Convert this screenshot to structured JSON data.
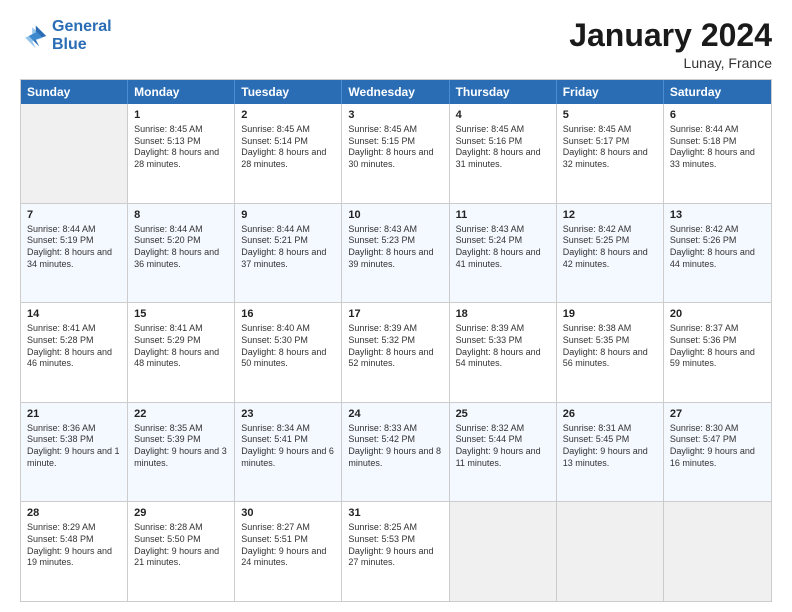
{
  "logo": {
    "line1": "General",
    "line2": "Blue"
  },
  "title": "January 2024",
  "location": "Lunay, France",
  "weekdays": [
    "Sunday",
    "Monday",
    "Tuesday",
    "Wednesday",
    "Thursday",
    "Friday",
    "Saturday"
  ],
  "rows": [
    [
      {
        "day": "",
        "sunrise": "",
        "sunset": "",
        "daylight": "",
        "empty": true
      },
      {
        "day": "1",
        "sunrise": "Sunrise: 8:45 AM",
        "sunset": "Sunset: 5:13 PM",
        "daylight": "Daylight: 8 hours and 28 minutes."
      },
      {
        "day": "2",
        "sunrise": "Sunrise: 8:45 AM",
        "sunset": "Sunset: 5:14 PM",
        "daylight": "Daylight: 8 hours and 28 minutes."
      },
      {
        "day": "3",
        "sunrise": "Sunrise: 8:45 AM",
        "sunset": "Sunset: 5:15 PM",
        "daylight": "Daylight: 8 hours and 30 minutes."
      },
      {
        "day": "4",
        "sunrise": "Sunrise: 8:45 AM",
        "sunset": "Sunset: 5:16 PM",
        "daylight": "Daylight: 8 hours and 31 minutes."
      },
      {
        "day": "5",
        "sunrise": "Sunrise: 8:45 AM",
        "sunset": "Sunset: 5:17 PM",
        "daylight": "Daylight: 8 hours and 32 minutes."
      },
      {
        "day": "6",
        "sunrise": "Sunrise: 8:44 AM",
        "sunset": "Sunset: 5:18 PM",
        "daylight": "Daylight: 8 hours and 33 minutes."
      }
    ],
    [
      {
        "day": "7",
        "sunrise": "Sunrise: 8:44 AM",
        "sunset": "Sunset: 5:19 PM",
        "daylight": "Daylight: 8 hours and 34 minutes."
      },
      {
        "day": "8",
        "sunrise": "Sunrise: 8:44 AM",
        "sunset": "Sunset: 5:20 PM",
        "daylight": "Daylight: 8 hours and 36 minutes."
      },
      {
        "day": "9",
        "sunrise": "Sunrise: 8:44 AM",
        "sunset": "Sunset: 5:21 PM",
        "daylight": "Daylight: 8 hours and 37 minutes."
      },
      {
        "day": "10",
        "sunrise": "Sunrise: 8:43 AM",
        "sunset": "Sunset: 5:23 PM",
        "daylight": "Daylight: 8 hours and 39 minutes."
      },
      {
        "day": "11",
        "sunrise": "Sunrise: 8:43 AM",
        "sunset": "Sunset: 5:24 PM",
        "daylight": "Daylight: 8 hours and 41 minutes."
      },
      {
        "day": "12",
        "sunrise": "Sunrise: 8:42 AM",
        "sunset": "Sunset: 5:25 PM",
        "daylight": "Daylight: 8 hours and 42 minutes."
      },
      {
        "day": "13",
        "sunrise": "Sunrise: 8:42 AM",
        "sunset": "Sunset: 5:26 PM",
        "daylight": "Daylight: 8 hours and 44 minutes."
      }
    ],
    [
      {
        "day": "14",
        "sunrise": "Sunrise: 8:41 AM",
        "sunset": "Sunset: 5:28 PM",
        "daylight": "Daylight: 8 hours and 46 minutes."
      },
      {
        "day": "15",
        "sunrise": "Sunrise: 8:41 AM",
        "sunset": "Sunset: 5:29 PM",
        "daylight": "Daylight: 8 hours and 48 minutes."
      },
      {
        "day": "16",
        "sunrise": "Sunrise: 8:40 AM",
        "sunset": "Sunset: 5:30 PM",
        "daylight": "Daylight: 8 hours and 50 minutes."
      },
      {
        "day": "17",
        "sunrise": "Sunrise: 8:39 AM",
        "sunset": "Sunset: 5:32 PM",
        "daylight": "Daylight: 8 hours and 52 minutes."
      },
      {
        "day": "18",
        "sunrise": "Sunrise: 8:39 AM",
        "sunset": "Sunset: 5:33 PM",
        "daylight": "Daylight: 8 hours and 54 minutes."
      },
      {
        "day": "19",
        "sunrise": "Sunrise: 8:38 AM",
        "sunset": "Sunset: 5:35 PM",
        "daylight": "Daylight: 8 hours and 56 minutes."
      },
      {
        "day": "20",
        "sunrise": "Sunrise: 8:37 AM",
        "sunset": "Sunset: 5:36 PM",
        "daylight": "Daylight: 8 hours and 59 minutes."
      }
    ],
    [
      {
        "day": "21",
        "sunrise": "Sunrise: 8:36 AM",
        "sunset": "Sunset: 5:38 PM",
        "daylight": "Daylight: 9 hours and 1 minute."
      },
      {
        "day": "22",
        "sunrise": "Sunrise: 8:35 AM",
        "sunset": "Sunset: 5:39 PM",
        "daylight": "Daylight: 9 hours and 3 minutes."
      },
      {
        "day": "23",
        "sunrise": "Sunrise: 8:34 AM",
        "sunset": "Sunset: 5:41 PM",
        "daylight": "Daylight: 9 hours and 6 minutes."
      },
      {
        "day": "24",
        "sunrise": "Sunrise: 8:33 AM",
        "sunset": "Sunset: 5:42 PM",
        "daylight": "Daylight: 9 hours and 8 minutes."
      },
      {
        "day": "25",
        "sunrise": "Sunrise: 8:32 AM",
        "sunset": "Sunset: 5:44 PM",
        "daylight": "Daylight: 9 hours and 11 minutes."
      },
      {
        "day": "26",
        "sunrise": "Sunrise: 8:31 AM",
        "sunset": "Sunset: 5:45 PM",
        "daylight": "Daylight: 9 hours and 13 minutes."
      },
      {
        "day": "27",
        "sunrise": "Sunrise: 8:30 AM",
        "sunset": "Sunset: 5:47 PM",
        "daylight": "Daylight: 9 hours and 16 minutes."
      }
    ],
    [
      {
        "day": "28",
        "sunrise": "Sunrise: 8:29 AM",
        "sunset": "Sunset: 5:48 PM",
        "daylight": "Daylight: 9 hours and 19 minutes."
      },
      {
        "day": "29",
        "sunrise": "Sunrise: 8:28 AM",
        "sunset": "Sunset: 5:50 PM",
        "daylight": "Daylight: 9 hours and 21 minutes."
      },
      {
        "day": "30",
        "sunrise": "Sunrise: 8:27 AM",
        "sunset": "Sunset: 5:51 PM",
        "daylight": "Daylight: 9 hours and 24 minutes."
      },
      {
        "day": "31",
        "sunrise": "Sunrise: 8:25 AM",
        "sunset": "Sunset: 5:53 PM",
        "daylight": "Daylight: 9 hours and 27 minutes."
      },
      {
        "day": "",
        "sunrise": "",
        "sunset": "",
        "daylight": "",
        "empty": true
      },
      {
        "day": "",
        "sunrise": "",
        "sunset": "",
        "daylight": "",
        "empty": true
      },
      {
        "day": "",
        "sunrise": "",
        "sunset": "",
        "daylight": "",
        "empty": true
      }
    ]
  ]
}
